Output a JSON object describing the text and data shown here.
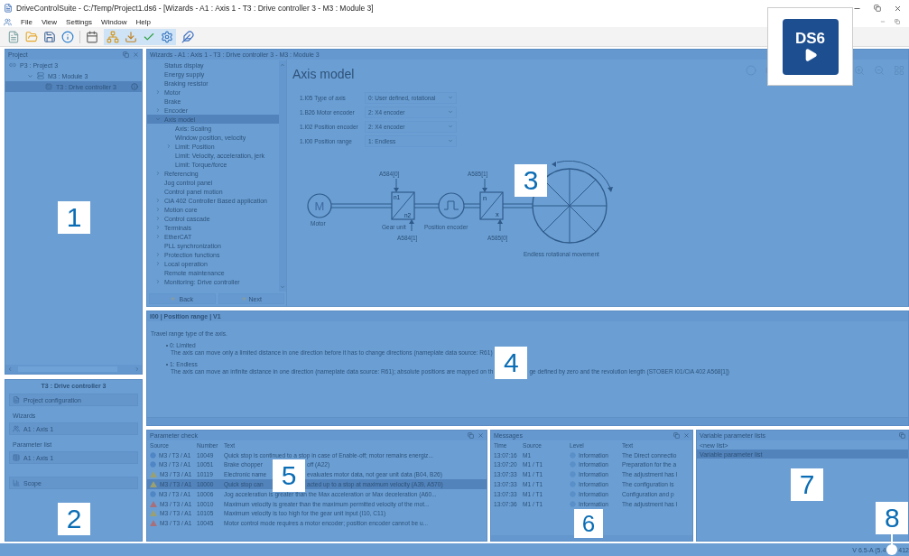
{
  "window": {
    "title": "DriveControlSuite - C:/Temp/Project1.ds6 - [Wizards - A1 : Axis 1 - T3 : Drive controller 3 - M3 : Module 3]"
  },
  "menu": [
    "File",
    "View",
    "Settings",
    "Window",
    "Help"
  ],
  "logo": {
    "text": "DS6"
  },
  "project": {
    "title": "Project",
    "tree": [
      {
        "label": "P3 : Project 3",
        "kind": "project",
        "selected": false,
        "children": [
          {
            "label": "M3 : Module 3",
            "kind": "module",
            "selected": false,
            "children": [
              {
                "label": "T3 : Drive controller 3",
                "kind": "controller",
                "selected": true
              }
            ]
          }
        ]
      }
    ]
  },
  "device": {
    "title": "T3 : Drive controller 3",
    "items": [
      {
        "kind": "button",
        "label": "Project configuration"
      },
      {
        "kind": "heading",
        "label": "Wizards"
      },
      {
        "kind": "button",
        "label": "A1 : Axis 1"
      },
      {
        "kind": "heading",
        "label": "Parameter list"
      },
      {
        "kind": "button",
        "label": "A1 : Axis 1"
      },
      {
        "kind": "button",
        "label": "Scope"
      }
    ]
  },
  "wizard": {
    "title": "Wizards - A1 : Axis 1 - T3 : Drive controller 3 - M3 : Module 3",
    "nav": [
      {
        "label": "Status display",
        "kind": "leaf",
        "selected": false
      },
      {
        "label": "Energy supply",
        "kind": "leaf",
        "selected": false
      },
      {
        "label": "Braking resistor",
        "kind": "leaf",
        "selected": false
      },
      {
        "label": "Motor",
        "kind": "group",
        "expanded": false,
        "selected": false
      },
      {
        "label": "Brake",
        "kind": "leaf",
        "selected": false
      },
      {
        "label": "Encoder",
        "kind": "group",
        "expanded": false,
        "selected": false
      },
      {
        "label": "Axis model",
        "kind": "group",
        "expanded": true,
        "selected": true,
        "children": [
          {
            "label": "Axis: Scaling",
            "kind": "leaf",
            "selected": false
          },
          {
            "label": "Window position, velocity",
            "kind": "leaf",
            "selected": false
          },
          {
            "label": "Limit: Position",
            "kind": "group",
            "expanded": false,
            "selected": false
          },
          {
            "label": "Limit: Velocity, acceleration, jerk",
            "kind": "leaf",
            "selected": false
          },
          {
            "label": "Limit: Torque/force",
            "kind": "leaf",
            "selected": false
          }
        ]
      },
      {
        "label": "Referencing",
        "kind": "group",
        "expanded": false,
        "selected": false
      },
      {
        "label": "Jog control panel",
        "kind": "leaf",
        "selected": false
      },
      {
        "label": "Control panel motion",
        "kind": "leaf",
        "selected": false
      },
      {
        "label": "CiA 402 Controller Based application",
        "kind": "group",
        "expanded": false,
        "selected": false
      },
      {
        "label": "Motion core",
        "kind": "group",
        "expanded": false,
        "selected": false
      },
      {
        "label": "Control cascade",
        "kind": "group",
        "expanded": false,
        "selected": false
      },
      {
        "label": "Terminals",
        "kind": "group",
        "expanded": false,
        "selected": false
      },
      {
        "label": "EtherCAT",
        "kind": "group",
        "expanded": false,
        "selected": false
      },
      {
        "label": "PLL synchronization",
        "kind": "leaf",
        "selected": false
      },
      {
        "label": "Protection functions",
        "kind": "group",
        "expanded": false,
        "selected": false
      },
      {
        "label": "Local operation",
        "kind": "group",
        "expanded": false,
        "selected": false
      },
      {
        "label": "Remote maintenance",
        "kind": "leaf",
        "selected": false
      },
      {
        "label": "Monitoring: Drive controller",
        "kind": "group",
        "expanded": false,
        "selected": false
      }
    ],
    "buttons": [
      "Back",
      "Next"
    ],
    "heading": "Axis model",
    "params": [
      {
        "label": "1.I05 Type of axis",
        "value": "0: User defined, rotational"
      },
      {
        "label": "1.B26 Motor encoder",
        "value": "2: X4 encoder"
      },
      {
        "label": "1.I02 Position encoder",
        "value": "2: X4 encoder"
      },
      {
        "label": "1.I00 Position range",
        "value": "1: Endless"
      }
    ],
    "diagram": {
      "motor_symbol": "M",
      "motor_label": "Motor",
      "gear_top_param": "A584[0]",
      "gear_input": "n1",
      "gear_output": "n2",
      "gear_label": "Gear unit",
      "gear_bottom_param": "A584[1]",
      "encoder_label": "Position encoder",
      "box_top_param": "A585[1]",
      "box_input": "n",
      "box_output": "x",
      "box_bottom_param": "A585[0]",
      "wheel_label": "Endless rotational movement"
    }
  },
  "info": {
    "title": "I00 | Position range | V1",
    "intro": "Travel range type of the axis.",
    "options": [
      {
        "title": "0: Limited",
        "text": "The axis can move only a limited distance in one direction before it has to change directions (nameplate data source: R61)"
      },
      {
        "title": "1: Endless",
        "text": "The axis can move an infinite distance in one direction (nameplate data source: R61); absolute positions are mapped on th",
        "text_end": "ge defined by zero and the revolution length (STOBER I01/CiA 402 A568[1])"
      }
    ]
  },
  "parameter_check": {
    "title": "Parameter check",
    "columns": [
      "Source",
      "Number",
      "Text"
    ],
    "rows": [
      {
        "kind": "info",
        "source": "M3 / T3 / A1",
        "number": "10049",
        "text": "Quick stop is continued to a stop in case of Enable-off; motor remains energiz...",
        "selected": false
      },
      {
        "kind": "info",
        "source": "M3 / T3 / A1",
        "number": "10051",
        "text": "Brake chopper",
        "text_end": "off (A22)",
        "selected": false
      },
      {
        "kind": "warning",
        "source": "M3 / T3 / A1",
        "number": "10119",
        "text": "Electronic name",
        "text_end": "evaluates motor data, not gear unit data (B04, B26)",
        "selected": false
      },
      {
        "kind": "warning",
        "source": "M3 / T3 / A1",
        "number": "10000",
        "text": "Quick stop can",
        "text_end": "acted up to a stop at maximum velocity (A39, A570)",
        "selected": true
      },
      {
        "kind": "info",
        "source": "M3 / T3 / A1",
        "number": "10006",
        "text": "Jog acceleration is greater than the Max acceleration or Max deceleration (A60...",
        "selected": false
      },
      {
        "kind": "error",
        "source": "M3 / T3 / A1",
        "number": "10010",
        "text": "Maximum velocity is greater than the maximum permitted velocity of the mot...",
        "selected": false
      },
      {
        "kind": "warning",
        "source": "M3 / T3 / A1",
        "number": "10105",
        "text": "Maximum velocity is too high for the gear unit input (I10, C11)",
        "selected": false
      },
      {
        "kind": "error",
        "source": "M3 / T3 / A1",
        "number": "10045",
        "text": "Motor control mode requires a motor encoder; position encoder cannot be u...",
        "selected": false
      }
    ]
  },
  "messages": {
    "title": "Messages",
    "columns": [
      "Time",
      "Source",
      "Level",
      "Text"
    ],
    "rows": [
      {
        "time": "13:07:16",
        "source": "M1",
        "level": "Information",
        "text": "The Direct connectio"
      },
      {
        "time": "13:07:20",
        "source": "M1 / T1",
        "level": "Information",
        "text": "Preparation for the a"
      },
      {
        "time": "13:07:33",
        "source": "M1 / T1",
        "level": "Information",
        "text": "The adjustment has l"
      },
      {
        "time": "13:07:33",
        "source": "M1 / T1",
        "level": "Information",
        "text": "The configuration is"
      },
      {
        "time": "13:07:33",
        "source": "M1 / T1",
        "level": "Information",
        "text": "Configuration and p"
      },
      {
        "time": "13:07:36",
        "source": "M1 / T1",
        "level": "Information",
        "text": "The adjustment has l"
      }
    ]
  },
  "parameter_lists": {
    "title": "Variable parameter lists",
    "items": [
      {
        "label": "<new list>",
        "selected": false
      },
      {
        "label": "Variable parameter list",
        "selected": true
      }
    ]
  },
  "status_bar": {
    "version": "V 6.5-A (5.4",
    "version_end": "412"
  },
  "markers": [
    "1",
    "2",
    "3",
    "4",
    "5",
    "6",
    "7",
    "8"
  ]
}
